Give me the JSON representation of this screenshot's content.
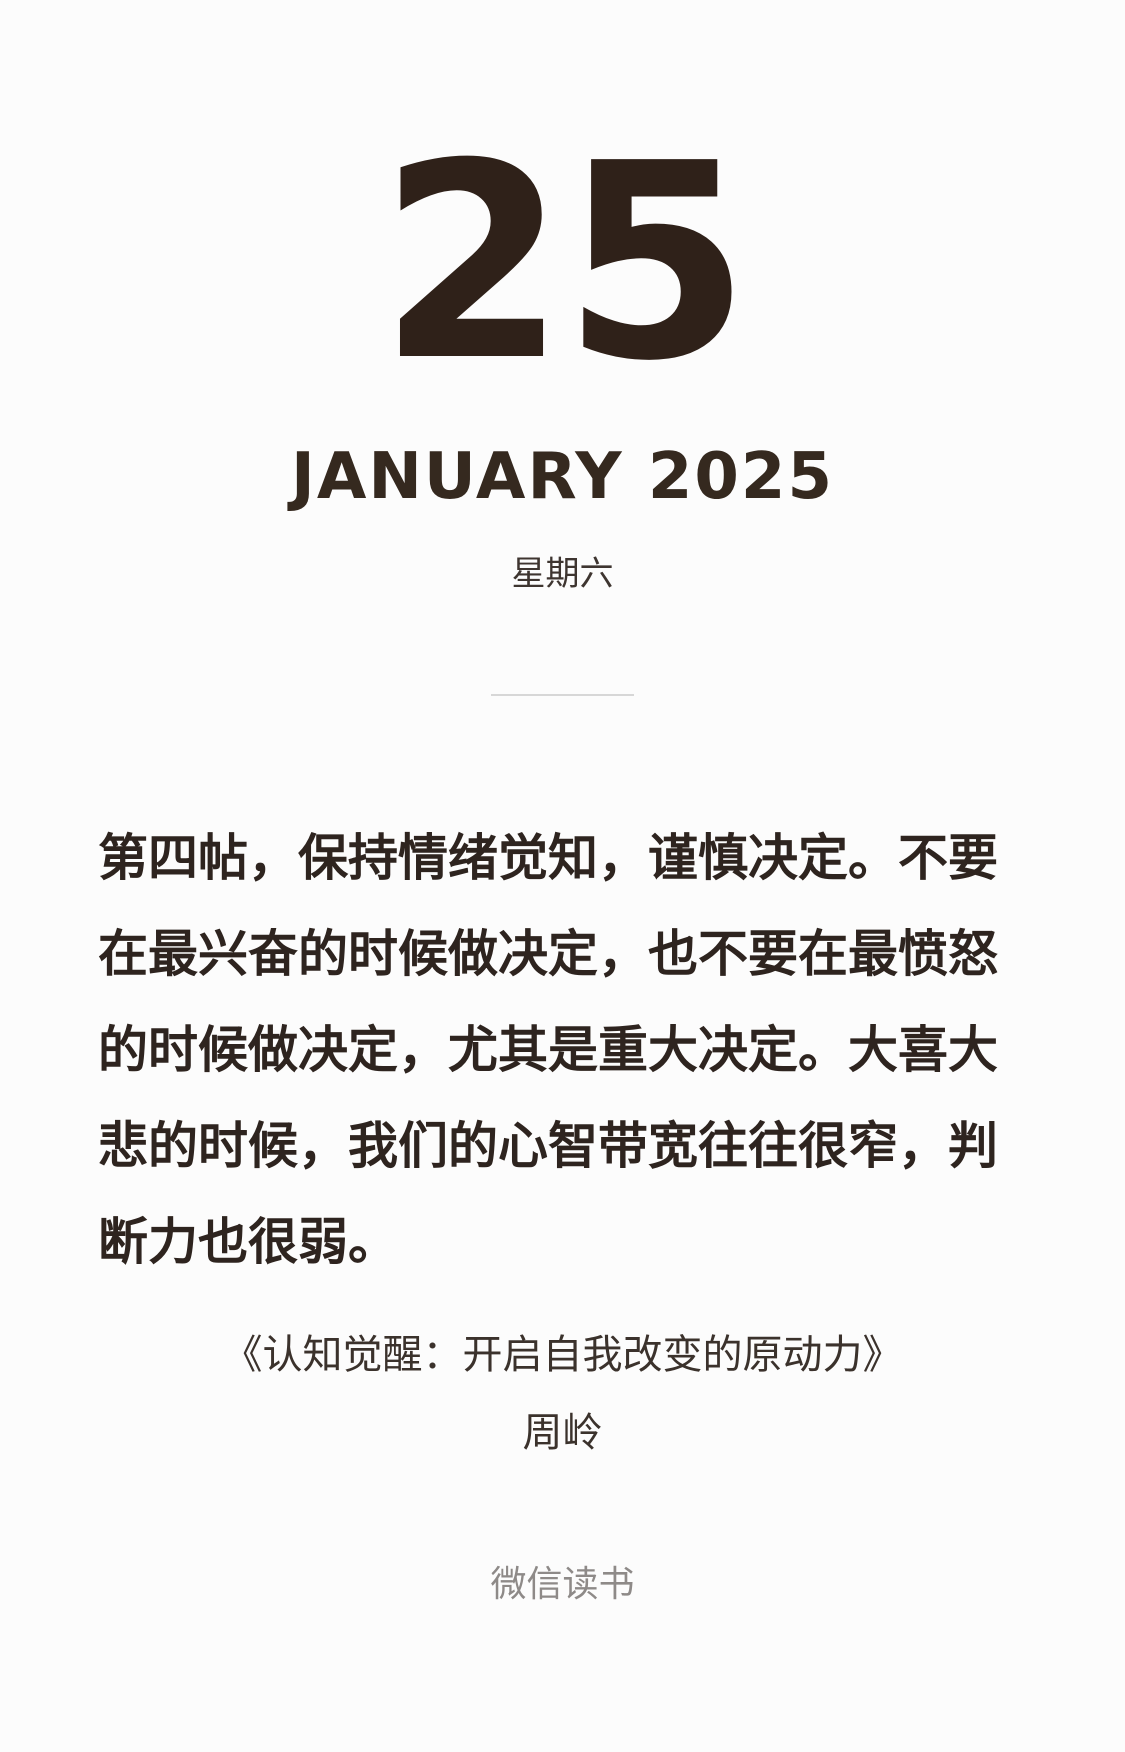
{
  "date": {
    "day": "25",
    "month_year": "JANUARY 2025",
    "weekday": "星期六"
  },
  "quote": {
    "lines": [
      "第四帖，保持情绪觉知，谨慎决定。不要",
      "在最兴奋的时候做决定，也不要在最愤怒",
      "的时候做决定，尤其是重大决定。大喜大",
      "悲的时候，我们的心智带宽往往很窄，判",
      "断力也很弱。"
    ]
  },
  "book": {
    "title": "《认知觉醒：开启自我改变的原动力》",
    "author": "周岭"
  },
  "footer": {
    "source": "微信读书"
  },
  "colors": {
    "background": "#fcfcfc",
    "primary_text": "#2f2119",
    "secondary_text": "#8e8a88",
    "divider": "#d7d7d7"
  }
}
